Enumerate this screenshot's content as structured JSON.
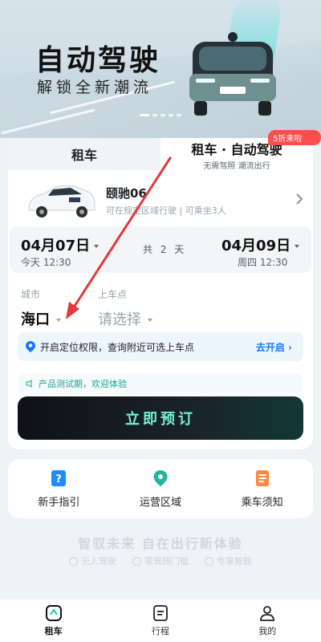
{
  "hero": {
    "title": "自动驾驶",
    "subtitle": "解锁全新潮流"
  },
  "tabs": {
    "left": "租车",
    "right_title": "租车 · 自动驾驶",
    "right_sub": "无需驾照 潮流出行",
    "badge": "5折来啦"
  },
  "car": {
    "name": "颐驰06",
    "desc": "可在规定区域行驶  |  可乘坐3人"
  },
  "dates": {
    "start": "04月07日",
    "start_sub": "今天 12:30",
    "end": "04月09日",
    "end_sub": "周四 12:30",
    "duration": "共 2 天"
  },
  "city": {
    "label": "城市",
    "value": "海口"
  },
  "pickup": {
    "label": "上车点",
    "placeholder": "请选择"
  },
  "location": {
    "text": "开启定位权限，查询附近可选上车点",
    "action": "去开启"
  },
  "notice": "产品测试期，欢迎体验",
  "book_button": "立即预订",
  "quick_links": [
    {
      "label": "新手指引",
      "icon": "guide-icon",
      "color": "#1c8cff"
    },
    {
      "label": "运营区域",
      "icon": "location-pin-icon",
      "color": "#22b59a"
    },
    {
      "label": "乘车须知",
      "icon": "notice-doc-icon",
      "color": "#ff8a3d"
    }
  ],
  "slogan": "智驭未来 自在出行新体验",
  "features": [
    "无人驾驶",
    "零驾照门槛",
    "专享智能"
  ],
  "bottom_nav": [
    {
      "label": "租车",
      "icon": "car-rental-icon",
      "active": true
    },
    {
      "label": "行程",
      "icon": "trip-icon",
      "active": false
    },
    {
      "label": "我的",
      "icon": "profile-icon",
      "active": false
    }
  ],
  "colors": {
    "accent_blue": "#1677ff",
    "accent_teal": "#73f2d6",
    "badge_red": "#ff4d4f",
    "annotation_red": "#e03a3a"
  }
}
